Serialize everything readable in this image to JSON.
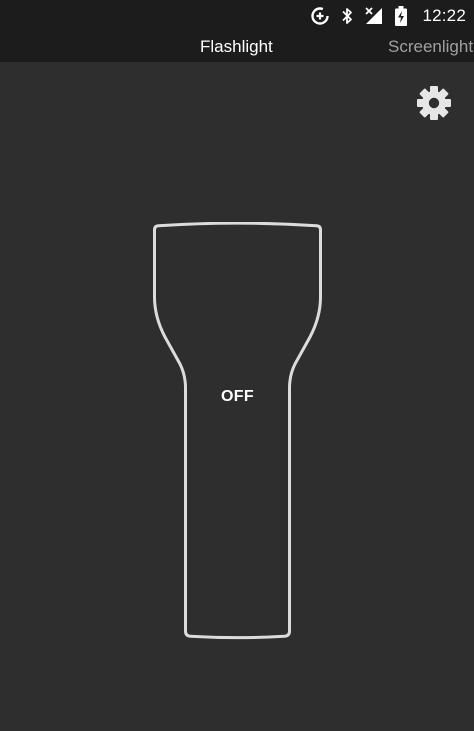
{
  "status_bar": {
    "time": "12:22",
    "icons": [
      "data-saver-icon",
      "bluetooth-icon",
      "no-signal-icon",
      "battery-charging-icon"
    ]
  },
  "tabs": [
    {
      "label": "Flashlight",
      "active": true
    },
    {
      "label": "Screenlight",
      "active": false
    }
  ],
  "settings": {
    "icon": "gear-icon"
  },
  "flashlight": {
    "state": "OFF"
  },
  "colors": {
    "background": "#2e2e2e",
    "bar": "#1c1c1c",
    "outline": "#dcdcdc",
    "active_tab": "#ffffff",
    "inactive_tab": "#a0a0a0"
  }
}
